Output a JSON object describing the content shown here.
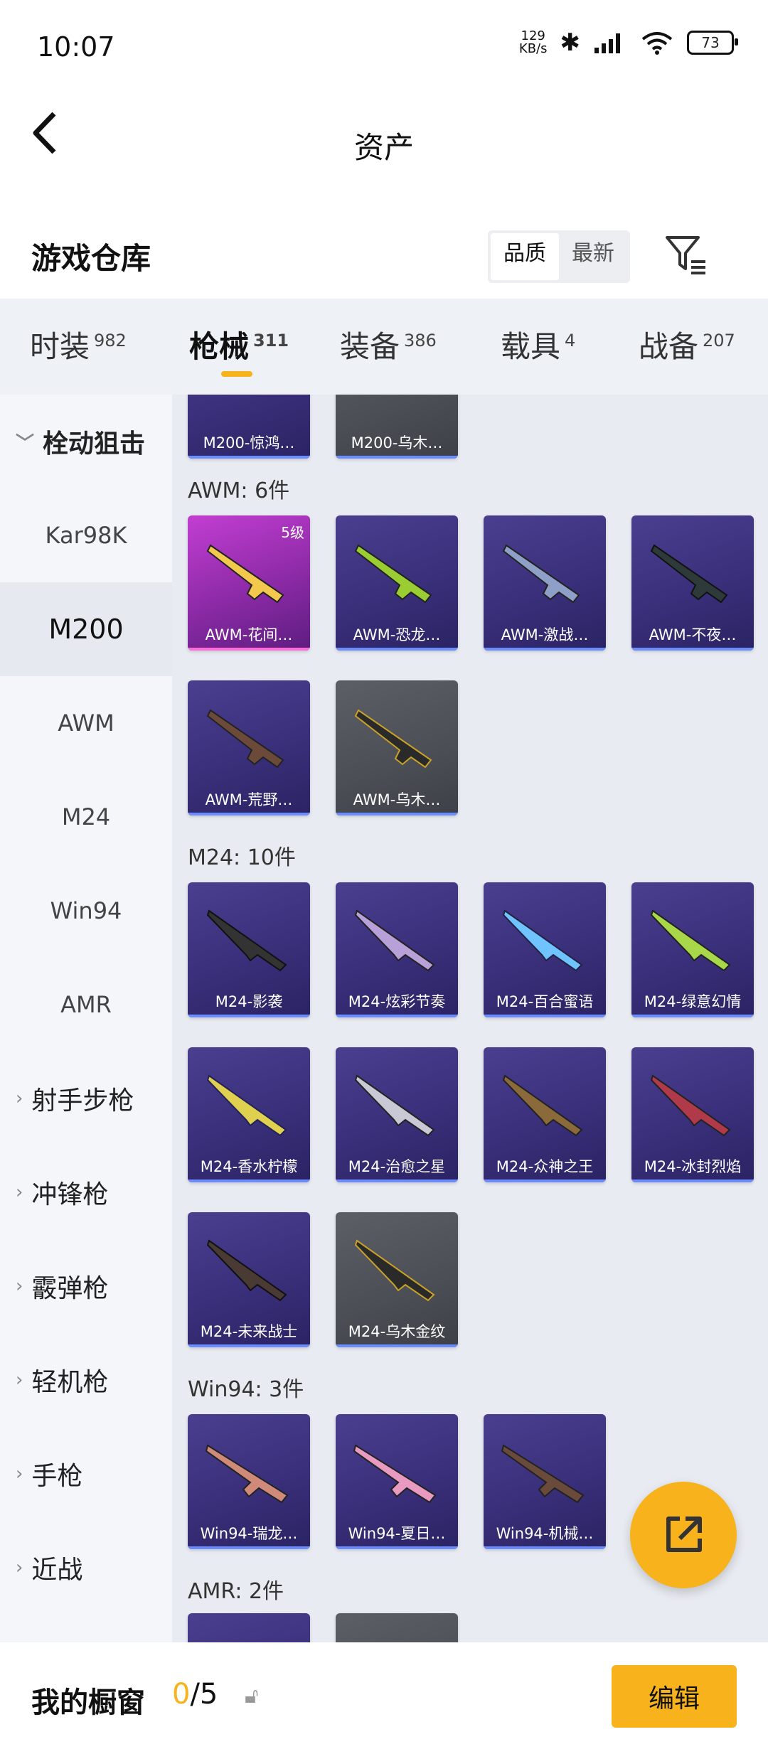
{
  "status_bar": {
    "time": "10:07",
    "net_speed_value": "129",
    "net_speed_unit": "KB/s",
    "battery": "73"
  },
  "header": {
    "title": "资产"
  },
  "warehouse": {
    "title": "游戏仓库",
    "sort_options": [
      "品质",
      "最新"
    ],
    "sort_selected": "品质"
  },
  "tabs": [
    {
      "label": "时装",
      "count": "982"
    },
    {
      "label": "枪械",
      "count": "311"
    },
    {
      "label": "装备",
      "count": "386"
    },
    {
      "label": "载具",
      "count": "4"
    },
    {
      "label": "战备",
      "count": "207"
    }
  ],
  "sidebar": {
    "group_bolt": "栓动狙击",
    "items": [
      "Kar98K",
      "M200",
      "AWM",
      "M24",
      "Win94",
      "AMR"
    ],
    "selected": "M200",
    "groups": [
      "射手步枪",
      "冲锋枪",
      "霰弹枪",
      "轻机枪",
      "手枪",
      "近战"
    ]
  },
  "sections": {
    "m200_cards": [
      "M200-惊鸿…",
      "M200-乌木…"
    ],
    "awm_title": "AWM: 6件",
    "awm_cards": [
      "AWM-花间…",
      "AWM-恐龙…",
      "AWM-激战…",
      "AWM-不夜…",
      "AWM-荒野…",
      "AWM-乌木…"
    ],
    "awm_level": "5级",
    "m24_title": "M24: 10件",
    "m24_cards": [
      "M24-影袭",
      "M24-炫彩节奏",
      "M24-百合蜜语",
      "M24-绿意幻情",
      "M24-香水柠檬",
      "M24-治愈之星",
      "M24-众神之王",
      "M24-冰封烈焰",
      "M24-未来战士",
      "M24-乌木金纹"
    ],
    "win94_title": "Win94: 3件",
    "win94_cards": [
      "Win94-瑞龙…",
      "Win94-夏日…",
      "Win94-机械…"
    ],
    "amr_title": "AMR: 2件"
  },
  "bottom": {
    "showcase_label": "我的橱窗",
    "showcase_current": "0",
    "showcase_total": "/5",
    "edit_label": "编辑"
  },
  "colors": {
    "accent": "#f7b21c",
    "card_purple": "#3a2f7a",
    "card_gold": "#b634c9",
    "card_grey": "#4b4e55"
  }
}
